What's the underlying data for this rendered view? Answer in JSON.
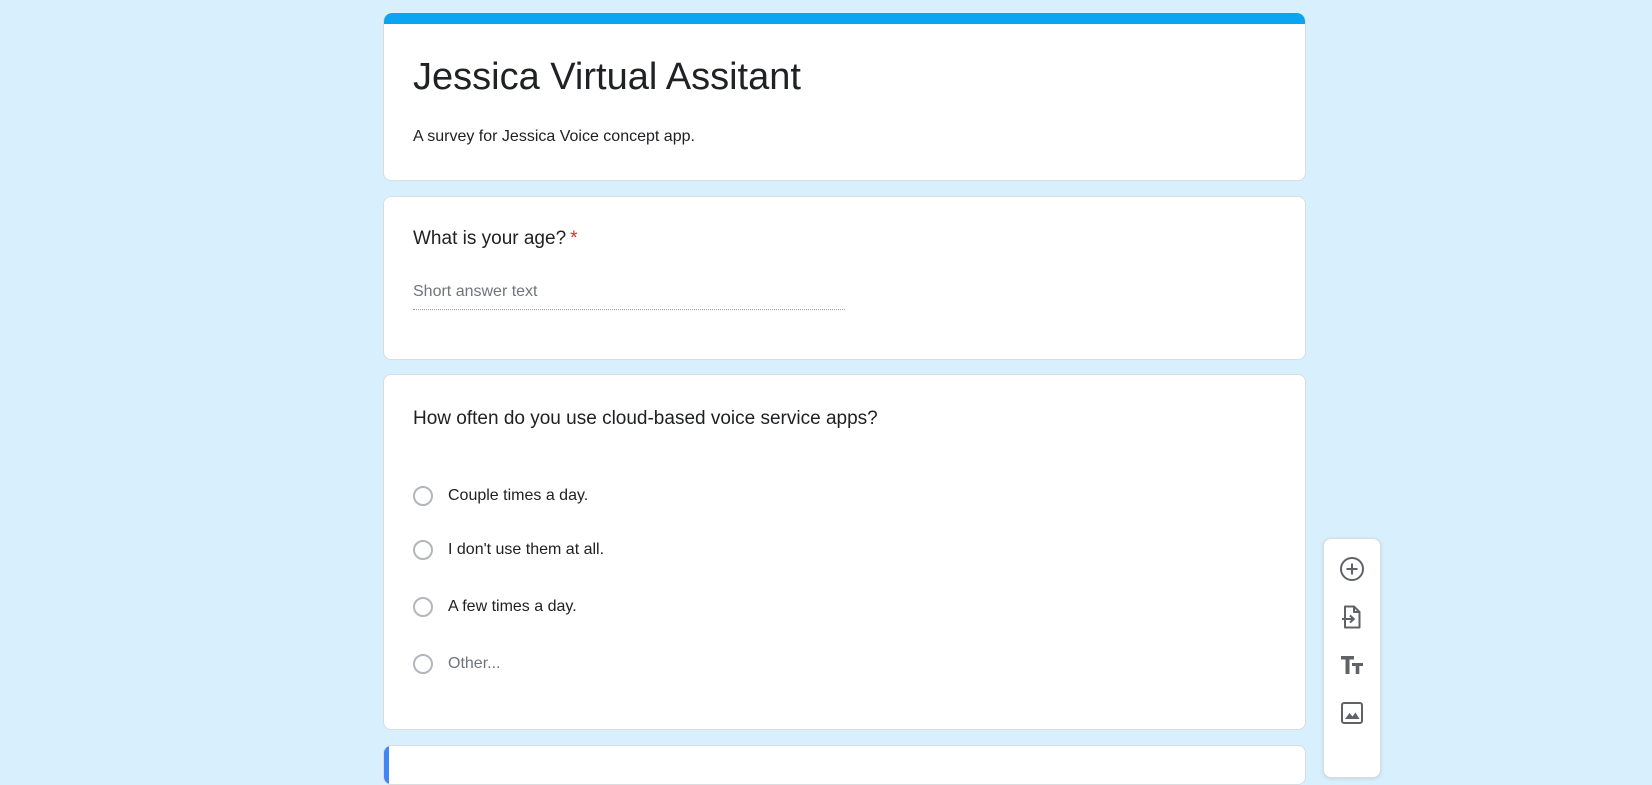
{
  "form": {
    "accent_color": "#0aa5f2",
    "background_color": "#d8effd",
    "title": "Jessica Virtual Assitant",
    "description": "A survey for Jessica Voice concept app."
  },
  "questions": [
    {
      "title": "What is your age?",
      "required": true,
      "required_marker": "*",
      "type": "short-answer",
      "placeholder": "Short answer text"
    },
    {
      "title": "How often do you use cloud-based voice service apps?",
      "required": false,
      "type": "multiple-choice",
      "options": [
        "Couple times a day.",
        "I don't use them at all.",
        "A few times a day.",
        "Other..."
      ]
    }
  ],
  "toolbar": {
    "items": [
      {
        "icon": "add-circle-icon"
      },
      {
        "icon": "import-question-icon"
      },
      {
        "icon": "title-text-icon"
      },
      {
        "icon": "image-icon"
      }
    ]
  }
}
